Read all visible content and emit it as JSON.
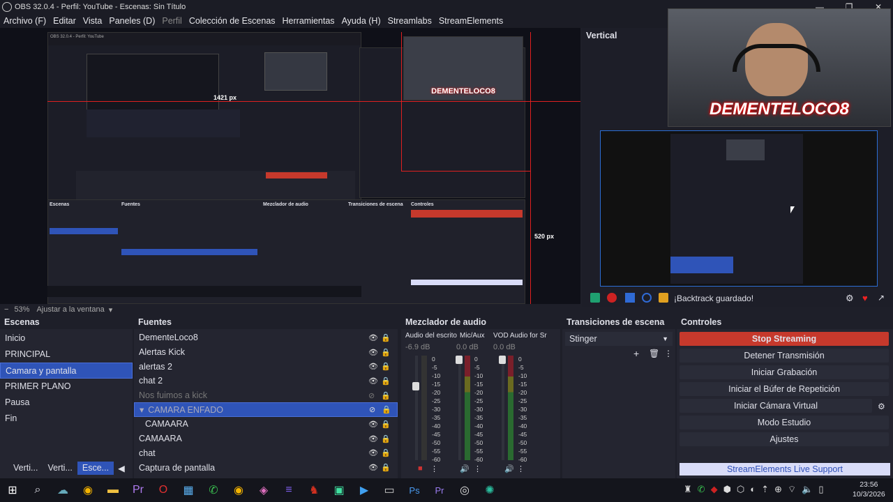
{
  "window": {
    "title": "OBS 32.0.4 - Perfil: YouTube - Escenas: Sin Título"
  },
  "menu": [
    "Archivo (F)",
    "Editar",
    "Vista",
    "Paneles (D)",
    "Perfil",
    "Colección de Escenas",
    "Herramientas",
    "Ayuda (H)",
    "Streamlabs",
    "StreamElements"
  ],
  "preview": {
    "zoom": "53%",
    "fit": "Ajustar a la ventana",
    "measure1": "1421 px",
    "measure2": "520 px",
    "inner_measure1": "1421 px",
    "inner_measure2": "520 px"
  },
  "webcam": {
    "brand": "DEMENTELOCO8"
  },
  "vertical": {
    "title": "Vertical",
    "status": "¡Backtrack guardado!"
  },
  "scenes": {
    "title": "Escenas",
    "items": [
      "Inicio",
      "PRINCIPAL",
      "Camara y pantalla",
      "PRIMER PLANO",
      "Pausa",
      "Fin"
    ],
    "tabs": [
      "Verti...",
      "Verti...",
      "Esce..."
    ]
  },
  "sources": {
    "title": "Fuentes",
    "items": [
      "DementeLoco8",
      "Alertas Kick",
      "alertas 2",
      "chat 2",
      "Nos fuimos a kick",
      "CAMARA ENFADO",
      "CAMAARA",
      "CAMAARA",
      "chat",
      "Captura de pantalla"
    ]
  },
  "mixer": {
    "title": "Mezclador de audio",
    "channels": [
      {
        "name": "Audio del escrito",
        "db": "-6.9 dB"
      },
      {
        "name": "Mic/Aux",
        "db": "0.0 dB"
      },
      {
        "name": "VOD Audio for Sr",
        "db": "0.0 dB"
      }
    ],
    "scale": [
      "0",
      "-5",
      "-10",
      "-15",
      "-20",
      "-25",
      "-30",
      "-35",
      "-40",
      "-45",
      "-50",
      "-55",
      "-60"
    ]
  },
  "transitions": {
    "title": "Transiciones de escena",
    "selected": "Stinger"
  },
  "controls": {
    "title": "Controles",
    "buttons": [
      "Stop Streaming",
      "Detener Transmisión",
      "Iniciar Grabación",
      "Iniciar el Búfer de Repetición",
      "Iniciar Cámara Virtual",
      "Modo Estudio",
      "Ajustes"
    ],
    "support": "StreamElements Live Support"
  },
  "taskbar": {
    "time": "23:56",
    "date": "10/3/2026"
  }
}
